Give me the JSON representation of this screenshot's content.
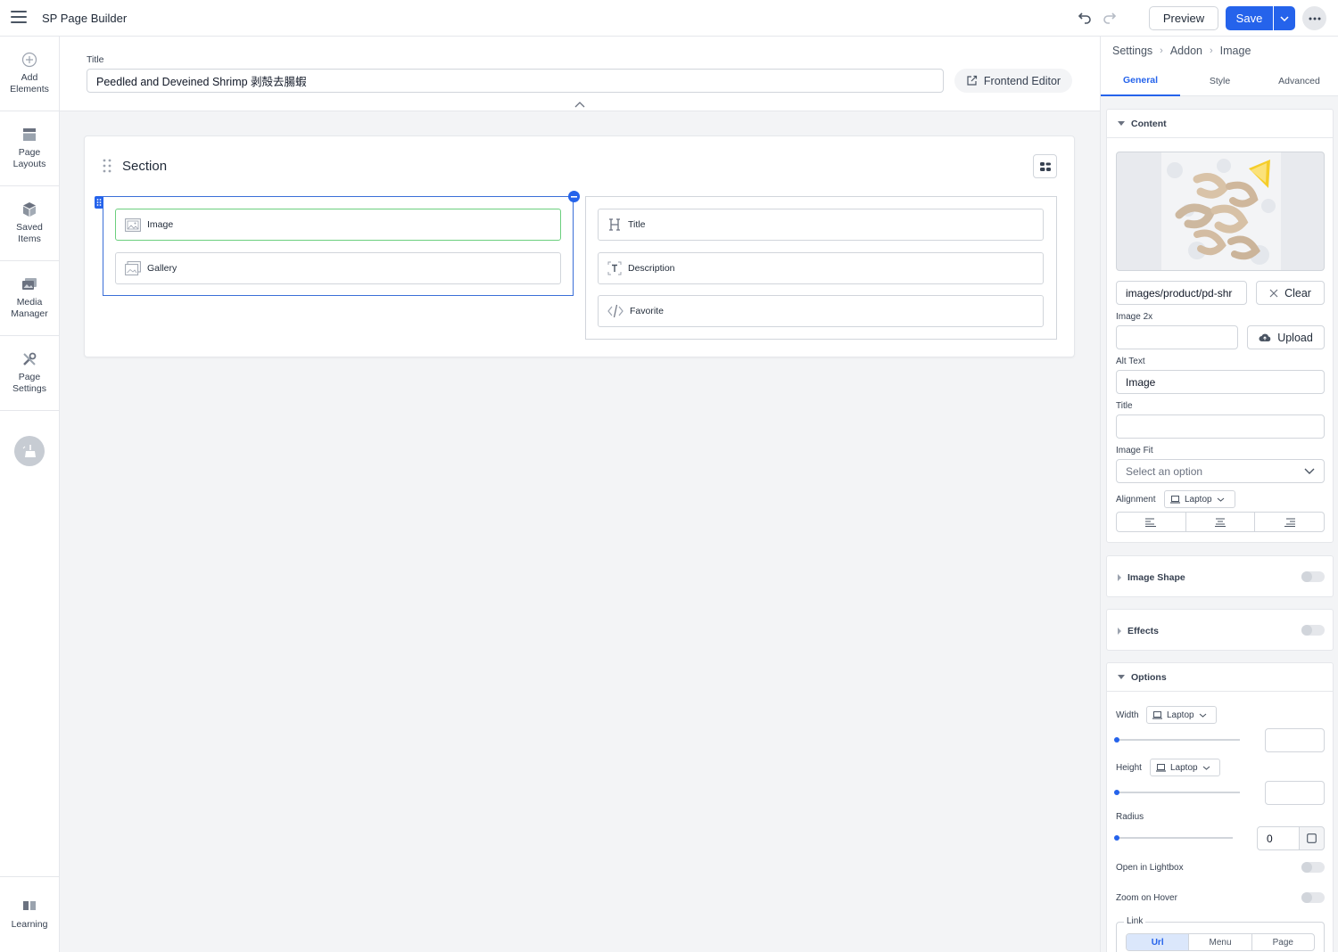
{
  "app": {
    "title": "SP Page Builder"
  },
  "toolbar": {
    "preview_label": "Preview",
    "save_label": "Save"
  },
  "sidebar": {
    "items": [
      {
        "icon": "plus-circle-icon",
        "label_line1": "Add",
        "label_line2": "Elements"
      },
      {
        "icon": "layout-icon",
        "label_line1": "Page",
        "label_line2": "Layouts"
      },
      {
        "icon": "box-icon",
        "label_line1": "Saved",
        "label_line2": "Items"
      },
      {
        "icon": "image-folder-icon",
        "label_line1": "Media",
        "label_line2": "Manager"
      },
      {
        "icon": "tools-icon",
        "label_line1": "Page",
        "label_line2": "Settings"
      }
    ],
    "learning_label": "Learning"
  },
  "page_title": {
    "label": "Title",
    "value": "Peedled and Deveined Shrimp 剥殻去腸蝦"
  },
  "frontend_editor_label": "Frontend Editor",
  "section": {
    "title": "Section",
    "columns": [
      {
        "addons": [
          {
            "icon": "image-icon",
            "label": "Image",
            "active": true
          },
          {
            "icon": "gallery-icon",
            "label": "Gallery"
          }
        ]
      },
      {
        "addons": [
          {
            "icon": "heading-icon",
            "label": "Title"
          },
          {
            "icon": "text-icon",
            "label": "Description"
          },
          {
            "icon": "code-icon",
            "label": "Favorite"
          }
        ]
      }
    ]
  },
  "panel": {
    "breadcrumb": [
      "Settings",
      "Addon",
      "Image"
    ],
    "tabs": [
      "General",
      "Style",
      "Advanced"
    ],
    "active_tab": "General",
    "content": {
      "header": "Content",
      "image_path": "images/product/pd-shr",
      "clear_label": "Clear",
      "image2x_label": "Image 2x",
      "upload_label": "Upload",
      "alt_text_label": "Alt Text",
      "alt_text_value": "Image",
      "title_label": "Title",
      "title_value": "",
      "image_fit_label": "Image Fit",
      "image_fit_placeholder": "Select an option",
      "alignment_label": "Alignment",
      "device": "Laptop"
    },
    "image_shape": {
      "header": "Image Shape",
      "enabled": false
    },
    "effects": {
      "header": "Effects",
      "enabled": false
    },
    "options": {
      "header": "Options",
      "width_label": "Width",
      "height_label": "Height",
      "radius_label": "Radius",
      "radius_value": "0",
      "device": "Laptop",
      "lightbox_label": "Open in Lightbox",
      "zoom_label": "Zoom on Hover",
      "link_label": "Link",
      "link_tabs": [
        "Url",
        "Menu",
        "Page"
      ]
    }
  },
  "colors": {
    "accent": "#2563eb",
    "active_addon_border": "#6ccf7e"
  }
}
